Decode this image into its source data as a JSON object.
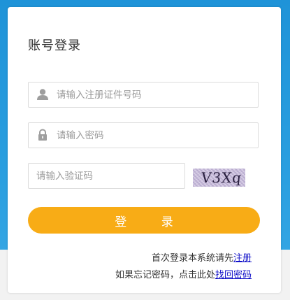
{
  "login": {
    "title": "账号登录",
    "id_placeholder": "请输入注册证件号码",
    "password_placeholder": "请输入密码",
    "captcha_placeholder": "请输入验证码",
    "captcha_text": "V3Xq",
    "login_button": "登  录",
    "register_prompt": "首次登录本系统请先",
    "register_link": "注册",
    "forgot_prompt": "如果忘记密码，点击此处",
    "forgot_link": "找回密码"
  },
  "icons": {
    "user": "user-icon",
    "lock": "lock-icon"
  },
  "colors": {
    "accent": "#f8ac16",
    "background": "#1f93d8",
    "link": "#1010c8"
  }
}
